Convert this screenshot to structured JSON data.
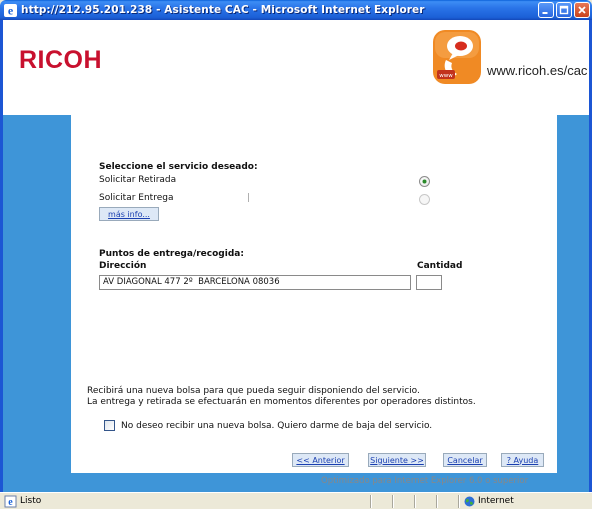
{
  "window": {
    "title": "http://212.95.201.238 - Asistente CAC - Microsoft Internet Explorer"
  },
  "header": {
    "brand": "RICOH",
    "site_url": "www.ricoh.es/cac",
    "logo_badge": "www"
  },
  "service": {
    "heading": "Seleccione el servicio deseado:",
    "options": [
      {
        "label": "Solicitar Retirada",
        "selected": true,
        "enabled": true
      },
      {
        "label": "Solicitar Entrega",
        "selected": false,
        "enabled": false
      }
    ],
    "more_info_button": "más info...",
    "separator": "|"
  },
  "points": {
    "heading": "Puntos de entrega/recogida:",
    "col_address": "Dirección",
    "col_quantity": "Cantidad",
    "address_value": "AV DIAGONAL 477 2º  BARCELONA 08036",
    "quantity_value": ""
  },
  "notice": {
    "line1": "Recibirá una nueva bolsa para que pueda seguir disponiendo del servicio.",
    "line2": "La entrega y retirada se efectuarán en momentos diferentes por operadores distintos."
  },
  "optout": {
    "label": "No deseo recibir una nueva bolsa. Quiero darme de baja del servicio.",
    "checked": false
  },
  "nav": {
    "previous": "<< Anterior",
    "next": "Siguiente >>",
    "cancel": "Cancelar",
    "help": "? Ayuda"
  },
  "footer_note": "Optimizado para Internet Explorer 6.0 o superior",
  "statusbar": {
    "status": "Listo",
    "zone": "Internet"
  },
  "colors": {
    "titlebar": "#2a74e8",
    "brand_red": "#c8102e",
    "side_blue": "#3e95d8",
    "logo_orange": "#f08a24"
  }
}
